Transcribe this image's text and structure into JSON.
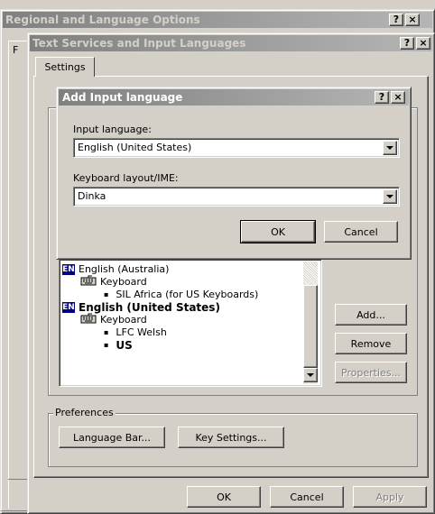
{
  "regional_window": {
    "title": "Regional and Language Options",
    "tab_label_partial": "F"
  },
  "text_services_window": {
    "title": "Text Services and Input Languages",
    "tab_settings": "Settings",
    "list_items": [
      {
        "type": "language",
        "badge": "EN",
        "label": "English (Australia)",
        "bold": false
      },
      {
        "type": "category",
        "label": "Keyboard",
        "bold": false
      },
      {
        "type": "layout",
        "label": "SIL Africa (for US Keyboards)",
        "bold": false
      },
      {
        "type": "language",
        "badge": "EN",
        "label": "English (United States)",
        "bold": true
      },
      {
        "type": "category",
        "label": "Keyboard",
        "bold": false
      },
      {
        "type": "layout",
        "label": "LFC Welsh",
        "bold": false
      },
      {
        "type": "layout",
        "label": "US",
        "bold": true
      }
    ],
    "add_button": "Add...",
    "remove_button": "Remove",
    "properties_button": "Properties...",
    "preferences_label": "Preferences",
    "language_bar_button": "Language Bar...",
    "key_settings_button": "Key Settings...",
    "ok_button": "OK",
    "cancel_button": "Cancel",
    "apply_button": "Apply"
  },
  "add_input_dialog": {
    "title": "Add Input language",
    "input_language_label": "Input language:",
    "input_language_value": "English (United States)",
    "keyboard_layout_label": "Keyboard layout/IME:",
    "keyboard_layout_value": "Dinka",
    "ok_button": "OK",
    "cancel_button": "Cancel"
  },
  "title_buttons": {
    "help": "?",
    "close": "×"
  },
  "bullet": "▪"
}
